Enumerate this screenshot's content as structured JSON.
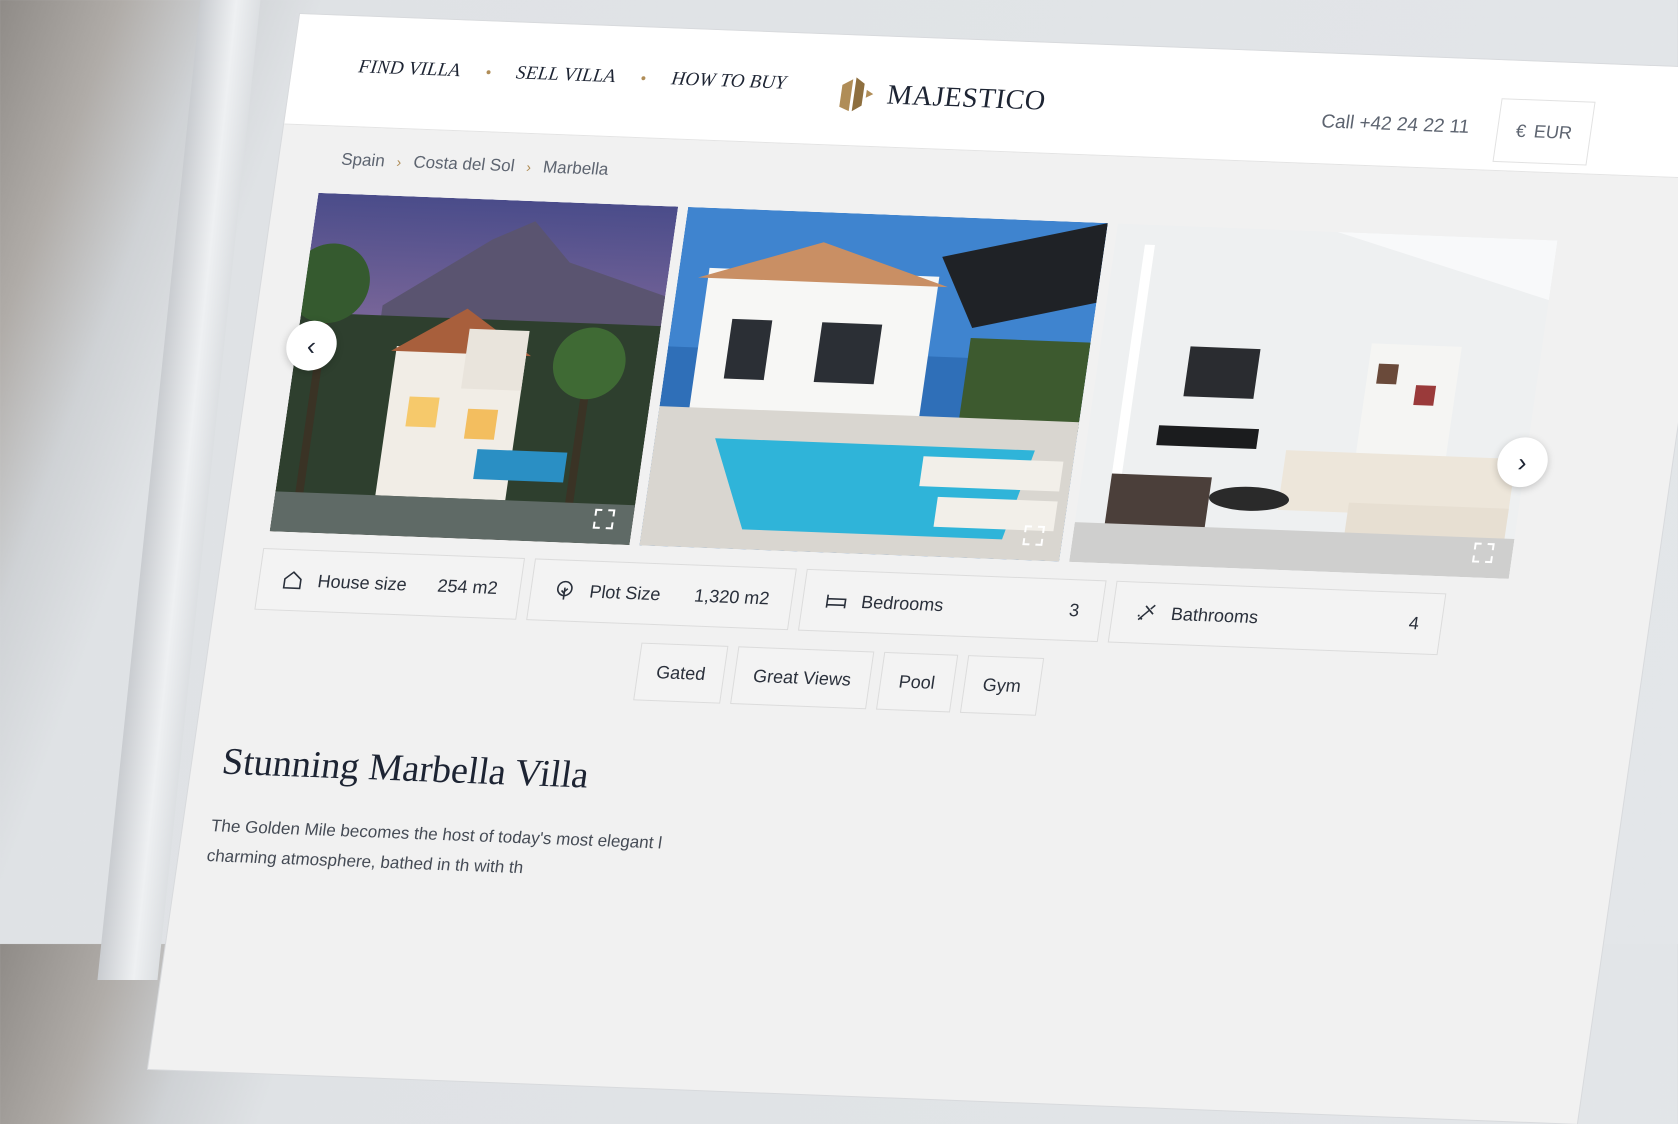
{
  "nav": {
    "items": [
      {
        "label": "FIND VILLA"
      },
      {
        "label": "SELL VILLA"
      },
      {
        "label": "HOW TO BUY"
      }
    ]
  },
  "logo": {
    "text": "MAJESTICO",
    "accent": "#b08d57"
  },
  "header": {
    "phone": "Call +42 24 22 11",
    "currency_symbol": "€",
    "currency": "EUR"
  },
  "breadcrumb": [
    "Spain",
    "Costa del Sol",
    "Marbella"
  ],
  "gallery": {
    "prev_icon": "chevron-left-icon",
    "next_icon": "chevron-right-icon",
    "photos": [
      {
        "name": "villa-exterior-dusk"
      },
      {
        "name": "villa-pool"
      },
      {
        "name": "villa-living-room"
      }
    ]
  },
  "stats": [
    {
      "label": "House size",
      "value": "254 m2",
      "icon": "house-icon"
    },
    {
      "label": "Plot Size",
      "value": "1,320 m2",
      "icon": "tree-icon"
    },
    {
      "label": "Bedrooms",
      "value": "3",
      "icon": "bed-icon"
    },
    {
      "label": "Bathrooms",
      "value": "4",
      "icon": "shower-icon"
    }
  ],
  "tags": [
    "Gated",
    "Great Views",
    "Pool",
    "Gym"
  ],
  "listing": {
    "title": "Stunning Marbella Villa",
    "description": "The Golden Mile becomes the host of today's most elegant l charming atmosphere, bathed in th with th"
  }
}
